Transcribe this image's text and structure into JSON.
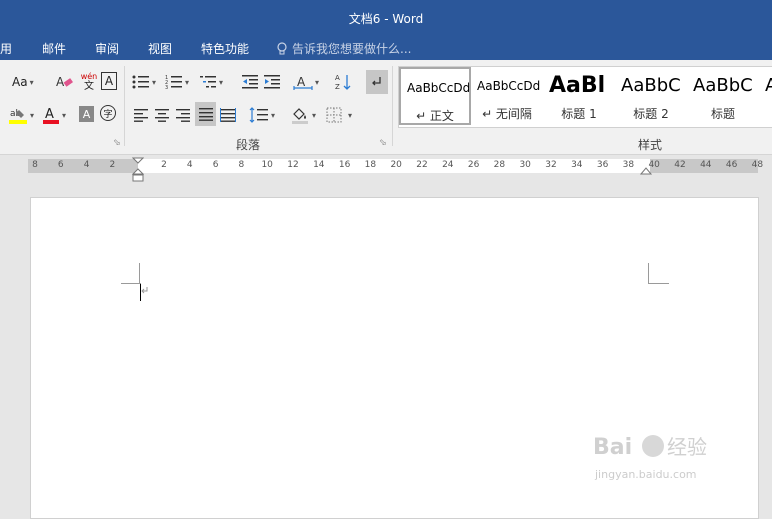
{
  "window": {
    "title": "文档6 - Word"
  },
  "tabs": [
    {
      "label": "用"
    },
    {
      "label": "邮件"
    },
    {
      "label": "审阅"
    },
    {
      "label": "视图"
    },
    {
      "label": "特色功能"
    }
  ],
  "tell_me": {
    "text": "告诉我您想要做什么..."
  },
  "font_group": {
    "change_case": "Aa",
    "phonetic_top": "wén",
    "phonetic_bottom": "文",
    "char_border": "A",
    "shading_char": "A",
    "enclose_char": "字"
  },
  "groups": {
    "paragraph": "段落",
    "styles": "样式"
  },
  "styles": [
    {
      "sample": "AaBbCcDd",
      "label": "↵ 正文"
    },
    {
      "sample": "AaBbCcDd",
      "label": "↵ 无间隔"
    },
    {
      "sample": "AaBl",
      "label": "标题 1"
    },
    {
      "sample": "AaBbC",
      "label": "标题 2"
    },
    {
      "sample": "AaBbC",
      "label": "标题"
    },
    {
      "sample": "A",
      "label": ""
    }
  ],
  "ruler": {
    "labels": [
      "8",
      "6",
      "4",
      "2",
      "2",
      "4",
      "6",
      "8",
      "10",
      "12",
      "14",
      "16",
      "18",
      "20",
      "22",
      "24",
      "26",
      "28",
      "30",
      "32",
      "34",
      "36",
      "38",
      "40",
      "42",
      "44",
      "46",
      "48"
    ]
  },
  "colors": {
    "accent": "#2b579a",
    "highlight": "#ffff00",
    "font_color": "#e81123"
  },
  "watermark": {
    "text": "Baidu 经验",
    "url": "jingyan.baidu.com"
  }
}
